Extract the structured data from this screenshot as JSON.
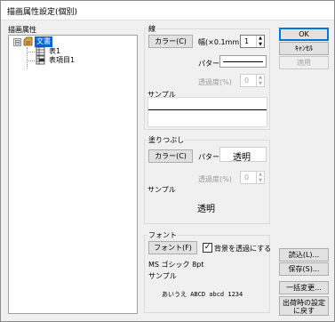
{
  "window": {
    "title": "描画属性設定(個別)"
  },
  "tree": {
    "label": "描画属性",
    "expander_symbol": "⊟",
    "items": [
      {
        "label": "文書",
        "icon": "document-folder-icon",
        "selected": true
      },
      {
        "label": "表1",
        "icon": "table-icon"
      },
      {
        "label": "表項目1",
        "icon": "table-item-icon"
      }
    ]
  },
  "line_section": {
    "label": "線",
    "color_button": "カラー(C)",
    "width_label": "幅(×0.1mm)",
    "width_value": "1",
    "pattern_label": "パターン",
    "transparency_label": "透過度(%)",
    "transparency_value": "0",
    "sample_label": "サンプル"
  },
  "fill_section": {
    "label": "塗りつぶし",
    "color_button": "カラー(C)",
    "pattern_label": "パターン",
    "pattern_value": "透明",
    "transparency_label": "透過度(%)",
    "transparency_value": "0",
    "sample_label": "サンプル",
    "sample_text": "透明"
  },
  "font_section": {
    "label": "フォント",
    "font_button": "フォント(F)",
    "transparent_bg_label": "背景を透過にする",
    "transparent_bg_checked": true,
    "font_name": "MS ゴシック 8pt",
    "sample_label": "サンプル",
    "sample_text": "あいうえ ABCD abcd 1234"
  },
  "buttons": {
    "ok": "OK",
    "cancel": "ｷｬﾝｾﾙ",
    "apply": "適用",
    "load": "読込(L)...",
    "save": "保存(S)...",
    "bulk_change": "一括変更...",
    "reset_line1": "出荷時の設定",
    "reset_line2": "に戻す"
  },
  "colors": {
    "selection": "#0a64d8",
    "default_button_border": "#0078d7"
  }
}
